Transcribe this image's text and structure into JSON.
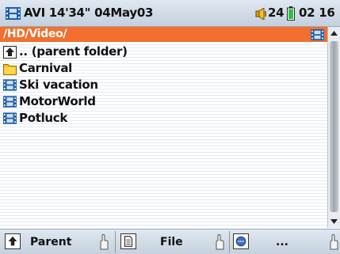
{
  "status": {
    "title": "AVI 14'34\" 04May03",
    "volume": "24",
    "battery_level_percent": 100,
    "time": "02 16"
  },
  "path": "/HD/Video/",
  "list": {
    "items": [
      {
        "label": ".. (parent folder)",
        "icon": "parent-folder-icon"
      },
      {
        "label": "Carnival",
        "icon": "folder-icon"
      },
      {
        "label": "Ski vacation",
        "icon": "film-icon"
      },
      {
        "label": "MotorWorld",
        "icon": "film-icon"
      },
      {
        "label": "Potluck",
        "icon": "film-icon"
      }
    ]
  },
  "toolbar": {
    "buttons": [
      {
        "label": "Parent",
        "icon": "parent-arrow-icon"
      },
      {
        "label": "File",
        "icon": "file-icon"
      },
      {
        "label": "...",
        "icon": "more-options-icon"
      }
    ]
  },
  "colors": {
    "path_bar": "#f26f2d",
    "folder": "#f7c21a",
    "film": "#1f5fa8",
    "battery": "#2bc23a"
  }
}
